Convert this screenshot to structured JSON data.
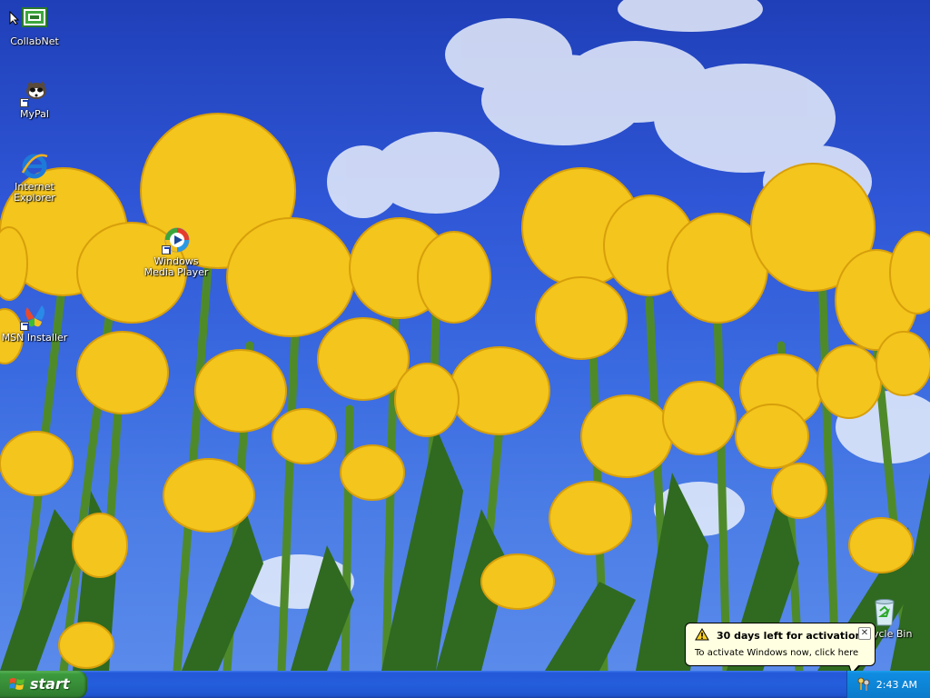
{
  "desktop": {
    "icons": [
      {
        "label": "CollabNet",
        "icon": "collabnet-icon"
      },
      {
        "label": "MyPal",
        "icon": "mypal-raccoon-icon"
      },
      {
        "label": "Internet Explorer",
        "icon": "internet-explorer-icon"
      },
      {
        "label": "Windows Media Player",
        "icon": "windows-media-player-icon"
      },
      {
        "label": "MSN Installer",
        "icon": "msn-butterfly-icon"
      },
      {
        "label": "ycle Bin",
        "icon": "recycle-bin-icon"
      }
    ]
  },
  "taskbar": {
    "start_label": "start",
    "clock": "2:43 AM",
    "tray_icon": "activation-keys-icon"
  },
  "balloon": {
    "title": "30 days left for activation",
    "text": "To activate Windows now, click here",
    "warning_icon": "warning-icon",
    "close_label": "✕"
  },
  "colors": {
    "taskbar_blue": "#245edc",
    "start_green": "#388e38",
    "tray_blue": "#0d86d8",
    "balloon_bg": "#ffffe1"
  }
}
